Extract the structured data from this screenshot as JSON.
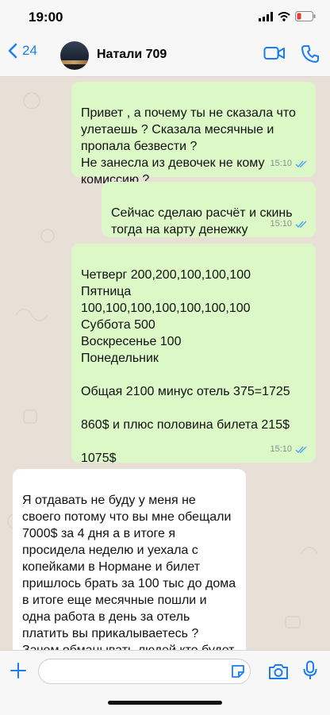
{
  "status": {
    "time": "19:00"
  },
  "header": {
    "back_count": "24",
    "contact_name": "Натали 709"
  },
  "messages": [
    {
      "direction": "out",
      "text": "Привет , а почему ты не сказала что улетаешь ? Сказала месячные и пропала безвести ?\nНе занесла из девочек не кому комиссию ?",
      "time": "15:10"
    },
    {
      "direction": "out",
      "text": "Сейчас сделаю расчёт и скинь тогда на карту денежку",
      "time": "15:10"
    },
    {
      "direction": "out",
      "text": "Четверг 200,200,100,100,100\nПятница\n100,100,100,100,100,100,100\nСуббота 500\nВоскресенье 100\nПонедельник\n\nОбщая 2100 минус отель 375=1725\n\n860$ и плюс половина билета 215$\n\n1075$",
      "time": "15:10"
    },
    {
      "direction": "in",
      "text": "Я отдавать не буду у меня не своего потому что вы мне обещали 7000$ за 4 дня а в итоге я просидела неделю и уехала с копейками в Нормане и билет пришлось брать за 100 тыс до дома в итоге еще месячные пошли и одна работа в день за отель платить вы прикалываетесь ? Зачем обманывать людей кто будет так",
      "time": ""
    }
  ],
  "composer": {
    "placeholder": ""
  },
  "colors": {
    "accent": "#1a7cf2",
    "outgoing": "#dcf8c6",
    "incoming": "#ffffff",
    "read_ticks": "#4fa3f7"
  }
}
